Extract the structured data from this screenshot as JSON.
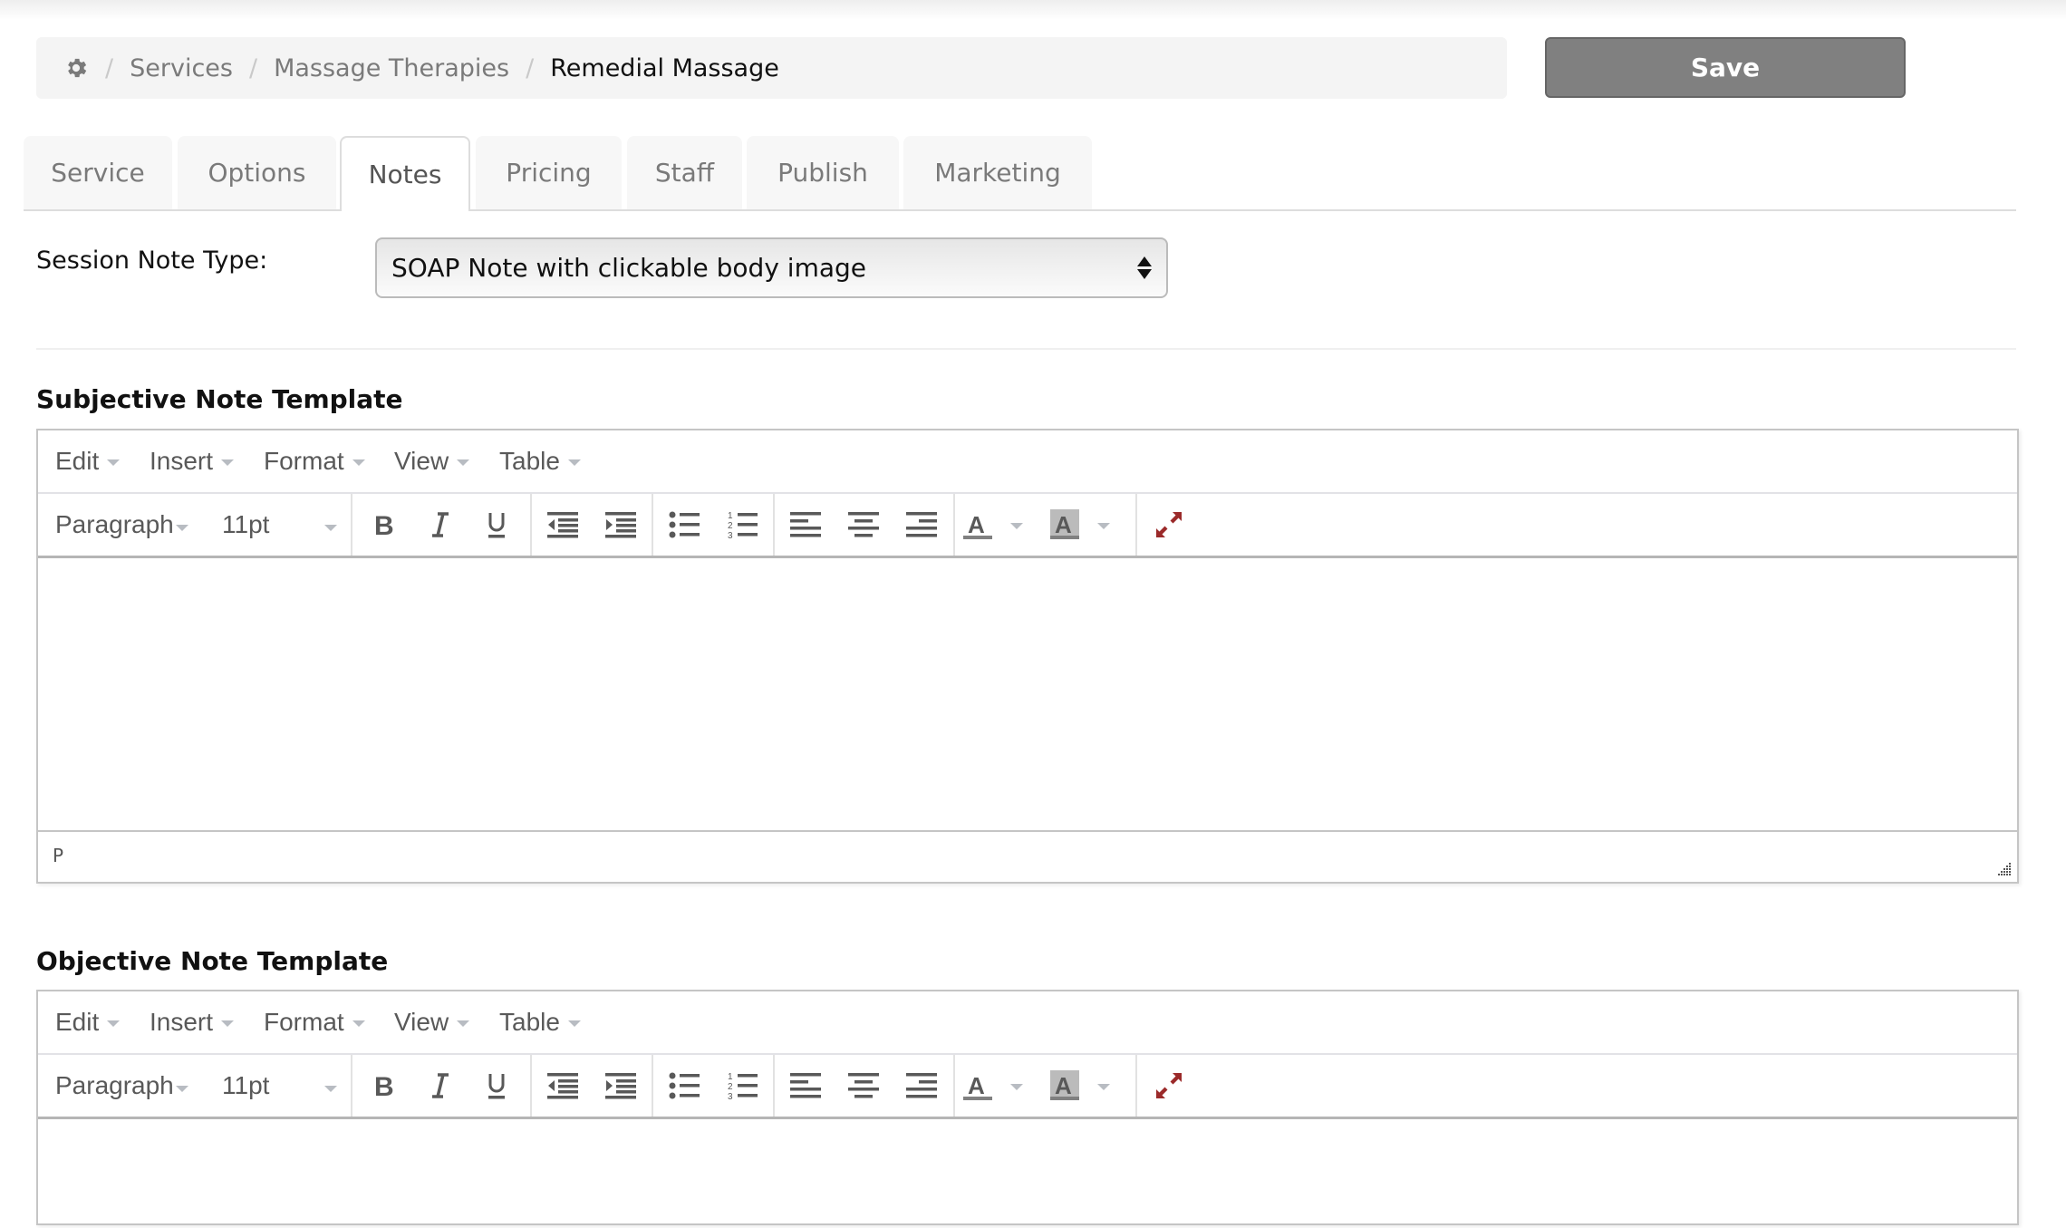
{
  "breadcrumb": {
    "root_icon": "gear-icon",
    "items": [
      "Services",
      "Massage Therapies"
    ],
    "current": "Remedial Massage",
    "separator": "/"
  },
  "actions": {
    "save_label": "Save"
  },
  "tabs": [
    {
      "label": "Service",
      "active": false
    },
    {
      "label": "Options",
      "active": false
    },
    {
      "label": "Notes",
      "active": true
    },
    {
      "label": "Pricing",
      "active": false
    },
    {
      "label": "Staff",
      "active": false
    },
    {
      "label": "Publish",
      "active": false
    },
    {
      "label": "Marketing",
      "active": false
    }
  ],
  "session_note": {
    "label": "Session Note Type:",
    "selected": "SOAP Note with clickable body image"
  },
  "editor_menu": [
    "Edit",
    "Insert",
    "Format",
    "View",
    "Table"
  ],
  "editor_toolbar": {
    "block_format": "Paragraph",
    "font_size": "11pt",
    "buttons": [
      "bold",
      "italic",
      "underline",
      "outdent",
      "indent",
      "bullet-list",
      "numbered-list",
      "align-left",
      "align-center",
      "align-right",
      "text-color",
      "background-color",
      "fullscreen"
    ]
  },
  "editors": [
    {
      "title": "Subjective Note Template",
      "content": "",
      "status_path": "P"
    },
    {
      "title": "Objective Note Template",
      "content": ""
    }
  ],
  "colors": {
    "save_bg": "#808080",
    "fullscreen_icon": "#9b2a2a",
    "breadcrumb_bg": "#f4f4f4"
  }
}
